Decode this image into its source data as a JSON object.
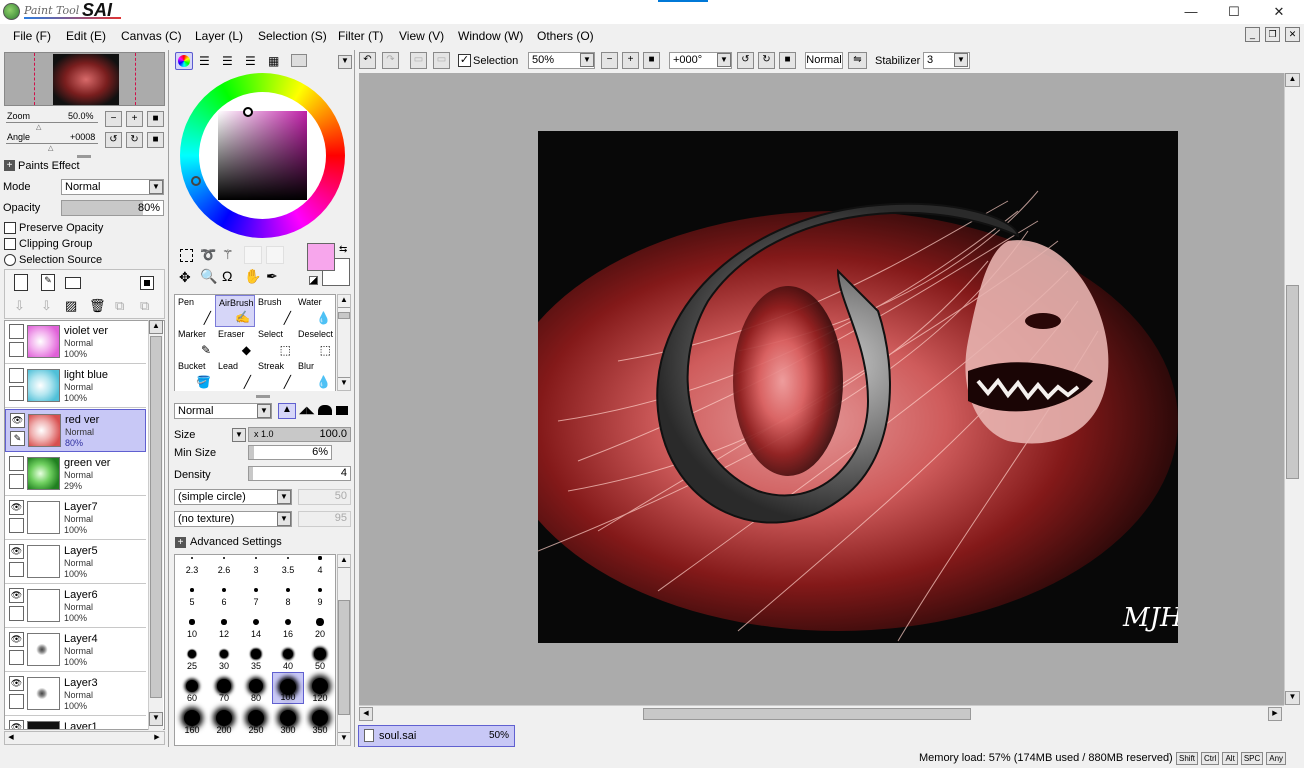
{
  "app": {
    "logo_small": "Paint Tool",
    "logo_big": "SAI"
  },
  "window_controls": {
    "minimize": "—",
    "maximize": "☐",
    "close": "✕"
  },
  "menu": [
    "File (F)",
    "Edit (E)",
    "Canvas (C)",
    "Layer (L)",
    "Selection (S)",
    "Filter (T)",
    "View (V)",
    "Window (W)",
    "Others (O)"
  ],
  "navigator": {
    "zoom_label": "Zoom",
    "zoom_value": "50.0%",
    "angle_label": "Angle",
    "angle_value": "+0008"
  },
  "layer_panel": {
    "paints_effect": "Paints Effect",
    "mode_label": "Mode",
    "mode_value": "Normal",
    "opacity_label": "Opacity",
    "opacity_value": "80%",
    "opacity_fill": 0.8,
    "preserve_opacity": "Preserve Opacity",
    "clipping_group": "Clipping Group",
    "selection_source": "Selection Source",
    "layers": [
      {
        "name": "violet ver",
        "mode": "Normal",
        "opacity": "100%",
        "visible": false,
        "selected": false,
        "thumb": "violet"
      },
      {
        "name": "light blue",
        "mode": "Normal",
        "opacity": "100%",
        "visible": false,
        "selected": false,
        "thumb": "lightblue"
      },
      {
        "name": "red ver",
        "mode": "Normal",
        "opacity": "80%",
        "visible": true,
        "selected": true,
        "thumb": "red"
      },
      {
        "name": "green ver",
        "mode": "Normal",
        "opacity": "29%",
        "visible": false,
        "selected": false,
        "thumb": "green"
      },
      {
        "name": "Layer7",
        "mode": "Normal",
        "opacity": "100%",
        "visible": true,
        "selected": false,
        "thumb": "white"
      },
      {
        "name": "Layer5",
        "mode": "Normal",
        "opacity": "100%",
        "visible": true,
        "selected": false,
        "thumb": "white"
      },
      {
        "name": "Layer6",
        "mode": "Normal",
        "opacity": "100%",
        "visible": true,
        "selected": false,
        "thumb": "white"
      },
      {
        "name": "Layer4",
        "mode": "Normal",
        "opacity": "100%",
        "visible": true,
        "selected": false,
        "thumb": "sketch"
      },
      {
        "name": "Layer3",
        "mode": "Normal",
        "opacity": "100%",
        "visible": true,
        "selected": false,
        "thumb": "sketch"
      },
      {
        "name": "Layer1",
        "mode": "",
        "opacity": "",
        "visible": true,
        "selected": false,
        "thumb": "black"
      }
    ]
  },
  "color": {
    "foreground": "#f7a6ec",
    "background": "#ffffff",
    "square_hue": "#c020a8"
  },
  "tools": [
    {
      "name": "Pen",
      "icon": "pen-icon",
      "selected": false
    },
    {
      "name": "AirBrush",
      "icon": "airbrush-icon",
      "selected": true
    },
    {
      "name": "Brush",
      "icon": "brush-icon",
      "selected": false
    },
    {
      "name": "Water",
      "icon": "water-icon",
      "selected": false
    },
    {
      "name": "Marker",
      "icon": "marker-icon",
      "selected": false
    },
    {
      "name": "Eraser",
      "icon": "eraser-icon",
      "selected": false
    },
    {
      "name": "Select",
      "icon": "select-icon",
      "selected": false
    },
    {
      "name": "Deselect",
      "icon": "deselect-icon",
      "selected": false
    },
    {
      "name": "Bucket",
      "icon": "bucket-icon",
      "selected": false
    },
    {
      "name": "Lead",
      "icon": "lead-icon",
      "selected": false
    },
    {
      "name": "Streak",
      "icon": "streak-icon",
      "selected": false
    },
    {
      "name": "Blur",
      "icon": "blur-icon",
      "selected": false
    }
  ],
  "brush": {
    "blend_mode": "Normal",
    "size_label": "Size",
    "size_mult": "x 1.0",
    "size_value": "100.0",
    "min_size_label": "Min Size",
    "min_size_value": "6%",
    "density_label": "Density",
    "density_value": "4",
    "shape": "(simple circle)",
    "shape_value": "50",
    "texture": "(no texture)",
    "texture_value": "95",
    "advanced": "Advanced Settings",
    "sizes": [
      "2.3",
      "2.6",
      "3",
      "3.5",
      "4",
      "5",
      "6",
      "7",
      "8",
      "9",
      "10",
      "12",
      "14",
      "16",
      "20",
      "25",
      "30",
      "35",
      "40",
      "50",
      "60",
      "70",
      "80",
      "100",
      "120",
      "160",
      "200",
      "250",
      "300",
      "350"
    ],
    "selected_size": "100"
  },
  "toolbar": {
    "selection_label": "Selection",
    "selection_checked": true,
    "zoom_value": "50%",
    "angle_value": "+000°",
    "mode_value": "Normal",
    "stabilizer_label": "Stabilizer",
    "stabilizer_value": "3"
  },
  "canvas": {
    "signature": "MJHV."
  },
  "doc_tab": {
    "file": "soul.sai",
    "zoom": "50%"
  },
  "status": {
    "memory": "Memory load: 57% (174MB used / 880MB reserved)",
    "keys": [
      "Shift",
      "Ctrl",
      "Alt",
      "SPC",
      "Any"
    ]
  }
}
